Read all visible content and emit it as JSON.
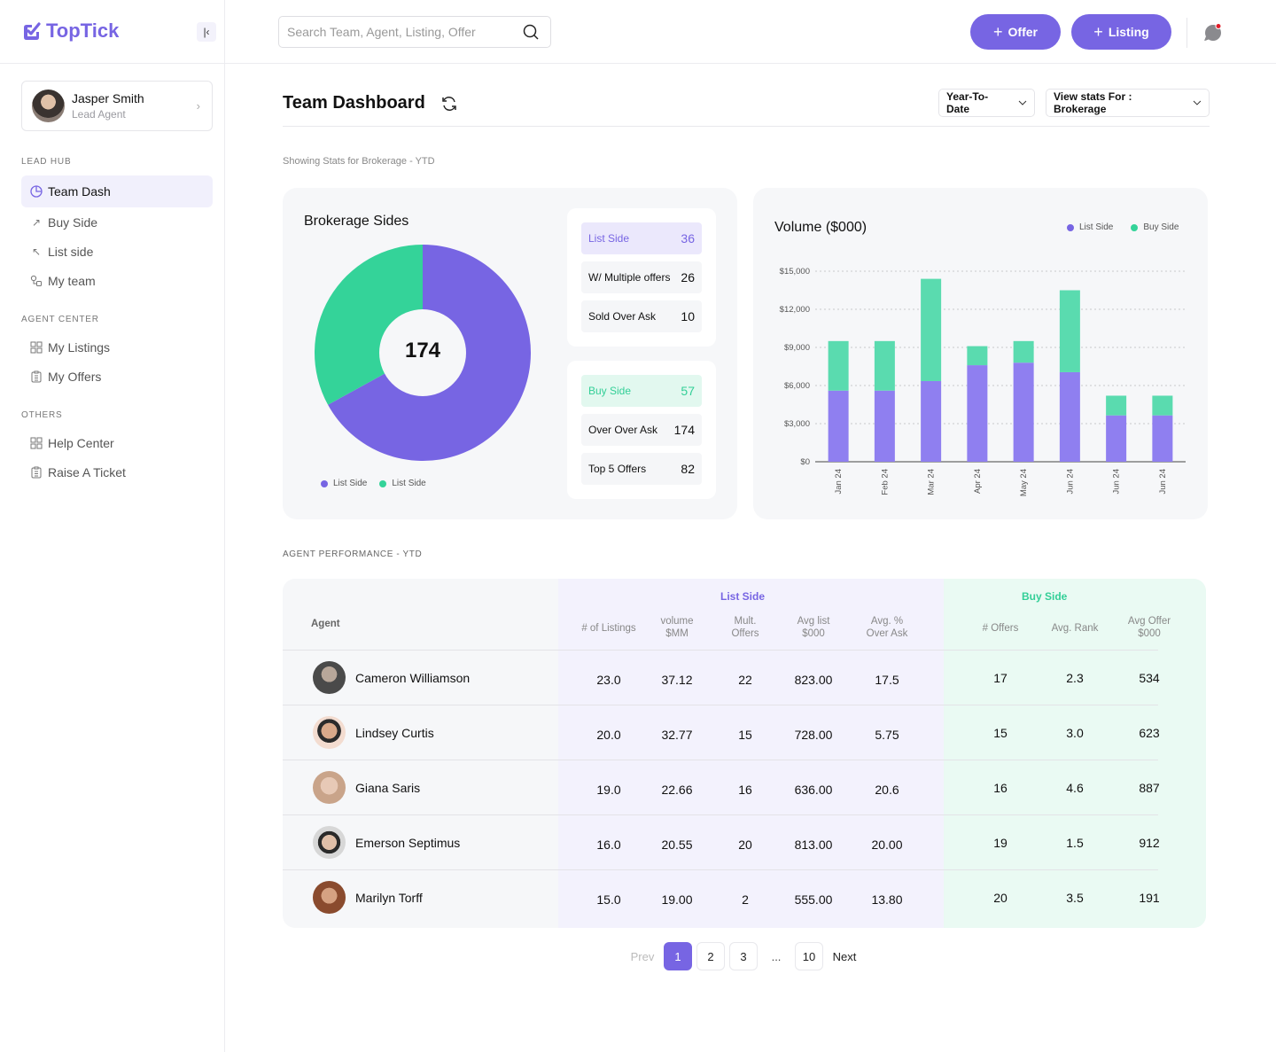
{
  "app": {
    "name": "TopTick"
  },
  "profile": {
    "name": "Jasper Smith",
    "role": "Lead Agent"
  },
  "sidebar": {
    "sections": [
      {
        "title": "LEAD HUB",
        "items": [
          {
            "label": "Team Dash",
            "icon": "pie-chart-icon",
            "active": true
          },
          {
            "label": "Buy Side",
            "icon": "arrow-up-right-icon"
          },
          {
            "label": "List side",
            "icon": "arrow-up-left-icon"
          },
          {
            "label": "My team",
            "icon": "team-icon"
          }
        ]
      },
      {
        "title": "AGENT CENTER",
        "items": [
          {
            "label": "My Listings",
            "icon": "grid-icon"
          },
          {
            "label": "My Offers",
            "icon": "clipboard-icon"
          }
        ]
      },
      {
        "title": "OTHERS",
        "items": [
          {
            "label": "Help Center",
            "icon": "grid-icon"
          },
          {
            "label": "Raise A Ticket",
            "icon": "clipboard-icon"
          }
        ]
      }
    ]
  },
  "search": {
    "placeholder": "Search Team, Agent, Listing, Offer",
    "value": ""
  },
  "header": {
    "offer_button": "Offer",
    "listing_button": "Listing",
    "plus": "+"
  },
  "page": {
    "title": "Team Dashboard",
    "period_select": "Year-To-Date",
    "stats_select": "View stats For : Brokerage",
    "subtitle": "Showing Stats for Brokerage - YTD"
  },
  "brokerage": {
    "title": "Brokerage Sides",
    "center_value": "174",
    "list_group": [
      {
        "label": "List Side",
        "value": "36"
      },
      {
        "label": "W/ Multiple offers",
        "value": "26"
      },
      {
        "label": "Sold Over Ask",
        "value": "10"
      }
    ],
    "buy_group": [
      {
        "label": "Buy Side",
        "value": "57"
      },
      {
        "label": "Over Over Ask",
        "value": "174"
      },
      {
        "label": "Top 5 Offers",
        "value": "82"
      }
    ]
  },
  "colors": {
    "list": "#7765e3",
    "buy": "#34d399",
    "list_bar": "#8f7ff0",
    "buy_bar": "#5adbaf"
  },
  "chart_data": [
    {
      "type": "pie",
      "title": "Brokerage Sides",
      "center_label": "174",
      "categories": [
        "List Side",
        "List Side"
      ],
      "values": [
        0.67,
        0.33
      ],
      "legend": [
        "List Side",
        "List Side"
      ],
      "legend_position": "bottom-left"
    },
    {
      "type": "bar",
      "stacked": true,
      "title": "Volume ($000)",
      "categories": [
        "Jan 24",
        "Feb 24",
        "Mar 24",
        "Apr 24",
        "May 24",
        "Jun 24",
        "Jun 24",
        "Jun 24"
      ],
      "series": [
        {
          "name": "List Side",
          "values": [
            5600,
            5600,
            6350,
            7600,
            7800,
            7050,
            3650,
            3650
          ]
        },
        {
          "name": "Buy Side",
          "values": [
            3900,
            3900,
            8050,
            1500,
            1700,
            6450,
            1550,
            1550
          ]
        }
      ],
      "yticks": [
        "$0",
        "$3,000",
        "$6,000",
        "$9,000",
        "$12,000",
        "$15,000"
      ],
      "ylim": [
        0,
        15000
      ],
      "grid": true,
      "legend_position": "top-right"
    }
  ],
  "table": {
    "section_title": "AGENT PERFORMANCE - YTD",
    "agent_header": "Agent",
    "list_group": "List Side",
    "buy_group": "Buy Side",
    "list_headers": [
      "# of Listings",
      "volume\n$MM",
      "Mult.\nOffers",
      "Avg list\n$000",
      "Avg. %\nOver Ask"
    ],
    "buy_headers": [
      "# Offers",
      "Avg. Rank",
      "Avg Offer\n$000"
    ],
    "rows": [
      {
        "name": "Cameron Williamson",
        "list": [
          "23.0",
          "37.12",
          "22",
          "823.00",
          "17.5"
        ],
        "buy": [
          "17",
          "2.3",
          "534"
        ]
      },
      {
        "name": "Lindsey Curtis",
        "list": [
          "20.0",
          "32.77",
          "15",
          "728.00",
          "5.75"
        ],
        "buy": [
          "15",
          "3.0",
          "623"
        ]
      },
      {
        "name": "Giana Saris",
        "list": [
          "19.0",
          "22.66",
          "16",
          "636.00",
          "20.6"
        ],
        "buy": [
          "16",
          "4.6",
          "887"
        ]
      },
      {
        "name": "Emerson Septimus",
        "list": [
          "16.0",
          "20.55",
          "20",
          "813.00",
          "20.00"
        ],
        "buy": [
          "19",
          "1.5",
          "912"
        ]
      },
      {
        "name": "Marilyn Torff",
        "list": [
          "15.0",
          "19.00",
          "2",
          "555.00",
          "13.80"
        ],
        "buy": [
          "20",
          "3.5",
          "191"
        ]
      }
    ]
  },
  "pagination": {
    "prev": "Prev",
    "pages": [
      "1",
      "2",
      "3"
    ],
    "ellipsis": "...",
    "last": "10",
    "next": "Next",
    "current": "1"
  }
}
